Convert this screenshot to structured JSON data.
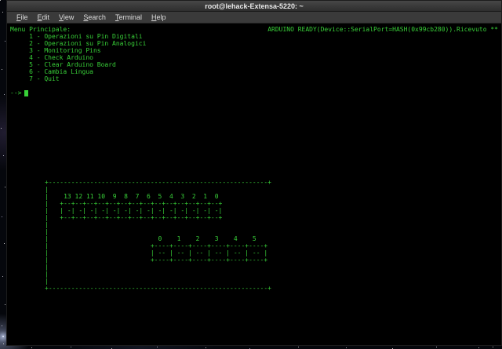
{
  "titlebar": {
    "title": "root@lehack-Extensa-5220: ~"
  },
  "menubar": {
    "items": [
      "File",
      "Edit",
      "View",
      "Search",
      "Terminal",
      "Help"
    ]
  },
  "terminal": {
    "status_left": "Menu Principale:",
    "status_right": "ARDUINO READY(Device::SerialPort=HASH(0x99cb280)).Ricevuto **",
    "menu_options": [
      "     1 - Operazioni su Pin Digitali",
      "     2 - Operazioni su Pin Analogici",
      "     3 - Monitoring Pins",
      "     4 - Check Arduino",
      "     5 - Clear Arduino Board",
      "     6 - Cambia Lingua",
      "     7 - Quit"
    ],
    "prompt": "-->",
    "board_art": [
      "+----------------------------------------------------------+",
      "|",
      "|    13 12 11 10  9  8  7  6  5  4  3  2  1  0",
      "|   +--+--+--+--+--+--+--+--+--+--+--+--+--+--+",
      "|   | -| -| -| -| -| -| -| -| -| -| -| -| -| -|",
      "|   +--+--+--+--+--+--+--+--+--+--+--+--+--+--+",
      "|",
      "|",
      "|                             0    1    2    3    4    5",
      "|                           +----+----+----+----+----+----+",
      "|                           | -- | -- | -- | -- | -- | -- |",
      "|                           +----+----+----+----+----+----+",
      "|",
      "|",
      "|",
      "+----------------------------------------------------------+"
    ]
  },
  "colors": {
    "terminal_text": "#38d038",
    "terminal_bg": "#000000",
    "titlebar_bg": "#3c3c3c"
  }
}
